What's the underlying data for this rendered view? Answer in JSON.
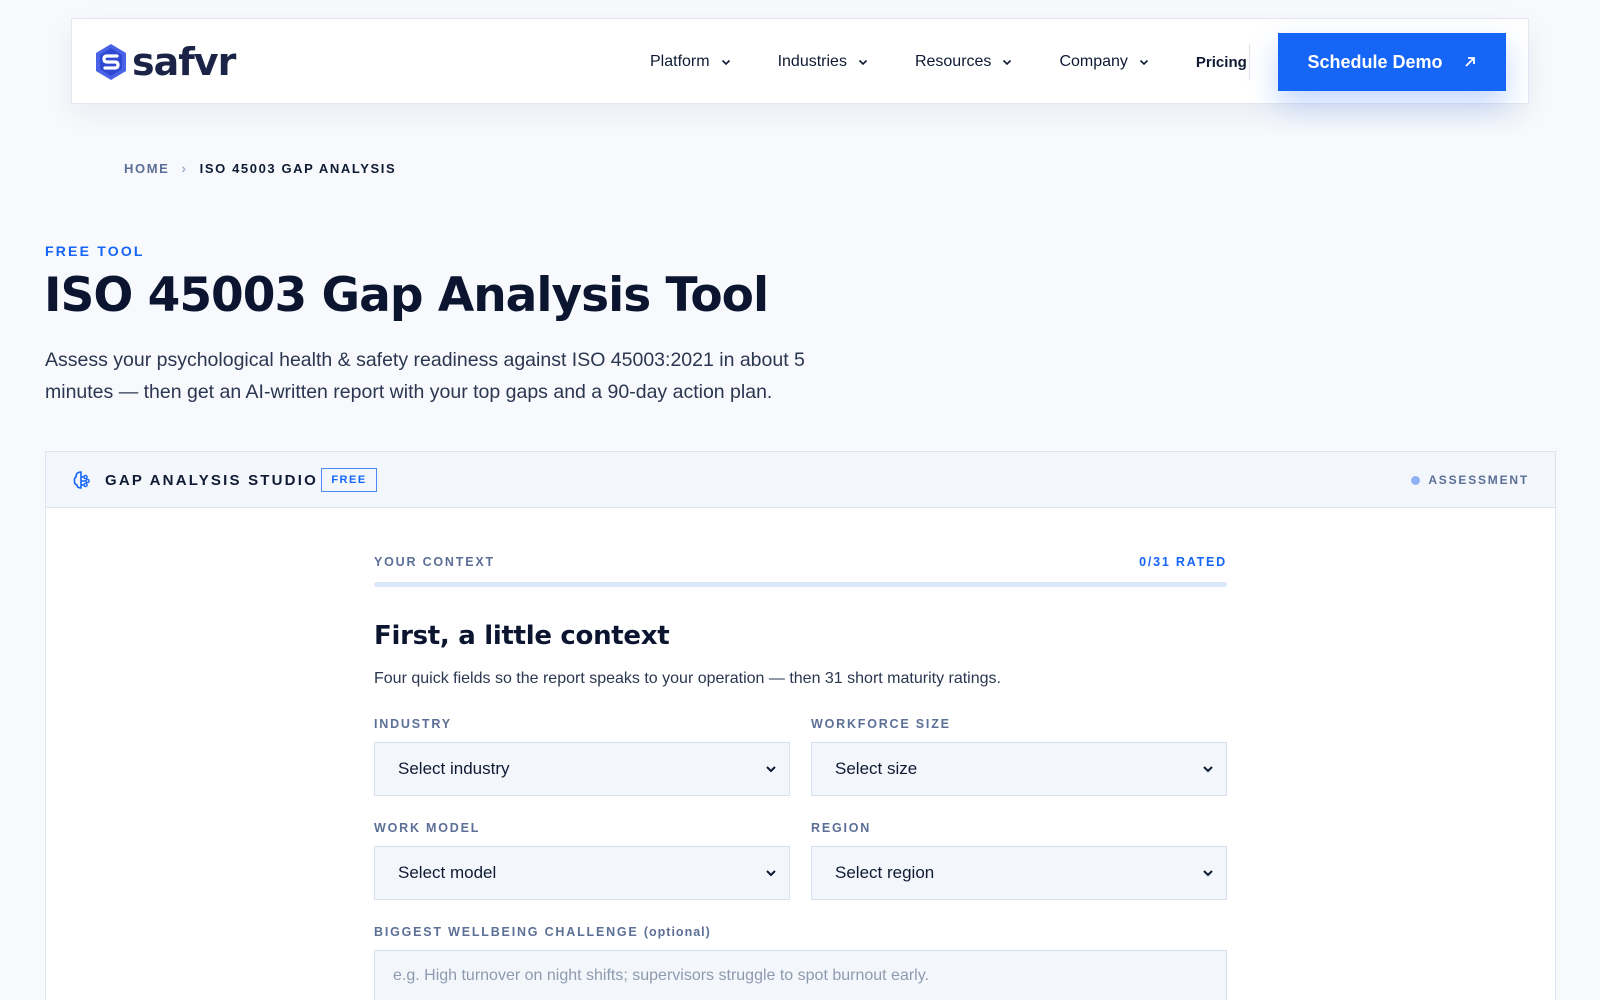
{
  "header": {
    "logo_text": "safvr",
    "nav": [
      {
        "label": "Platform",
        "has_dropdown": true
      },
      {
        "label": "Industries",
        "has_dropdown": true
      },
      {
        "label": "Resources",
        "has_dropdown": true
      },
      {
        "label": "Company",
        "has_dropdown": true
      }
    ],
    "pricing_label": "Pricing",
    "cta_label": "Schedule Demo",
    "cta_icon": "arrow-up-right-icon"
  },
  "breadcrumb": {
    "home": "HOME",
    "current": "ISO 45003 GAP ANALYSIS"
  },
  "hero": {
    "eyebrow": "FREE TOOL",
    "title": "ISO 45003 Gap Analysis Tool",
    "subtitle": "Assess your psychological health & safety readiness against ISO 45003:2021 in about 5 minutes — then get an AI-written report with your top gaps and a 90-day action plan."
  },
  "studio": {
    "icon": "brain-icon",
    "title": "GAP ANALYSIS STUDIO",
    "badge": "FREE",
    "status": "ASSESSMENT",
    "progress": {
      "label": "YOUR CONTEXT",
      "count": "0/31 RATED",
      "rated": 0,
      "total": 31
    },
    "form": {
      "title": "First, a little context",
      "subtitle": "Four quick fields so the report speaks to your operation — then 31 short maturity ratings.",
      "fields": {
        "industry": {
          "label": "INDUSTRY",
          "value": "Select industry"
        },
        "workforce": {
          "label": "WORKFORCE SIZE",
          "value": "Select size"
        },
        "work_model": {
          "label": "WORK MODEL",
          "value": "Select model"
        },
        "region": {
          "label": "REGION",
          "value": "Select region"
        }
      },
      "challenge": {
        "label": "BIGGEST WELLBEING CHALLENGE",
        "optional": "(optional)",
        "placeholder": "e.g. High turnover on night shifts; supervisors struggle to spot burnout early."
      }
    }
  },
  "colors": {
    "accent": "#1565f6",
    "heading": "#0b1530",
    "muted_label": "#5c6f96",
    "field_bg": "#f3f7fc"
  }
}
